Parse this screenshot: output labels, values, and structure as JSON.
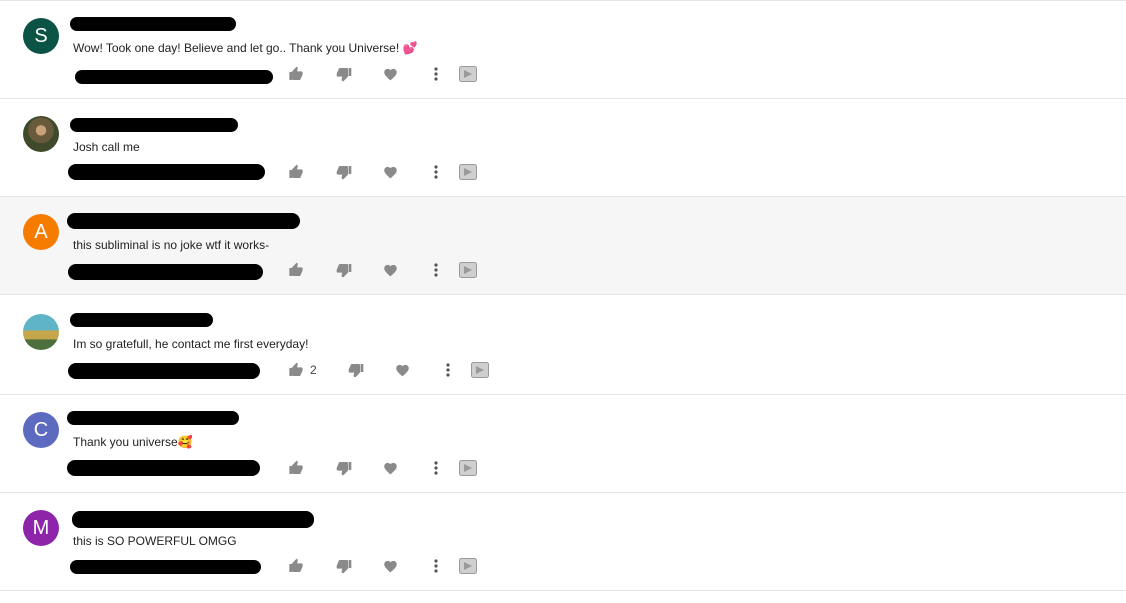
{
  "comments": [
    {
      "avatar_letter": "S",
      "avatar_color": "#0b5345",
      "text": "Wow! Took one day! Believe and let go.. Thank you Universe! 💕",
      "likes": ""
    },
    {
      "avatar_letter": "",
      "avatar_color": "",
      "text": "Josh call me",
      "likes": ""
    },
    {
      "avatar_letter": "A",
      "avatar_color": "#f57c00",
      "text": "this subliminal is no joke wtf it works-",
      "likes": ""
    },
    {
      "avatar_letter": "",
      "avatar_color": "",
      "text": "Im so gratefull, he contact me first everyday!",
      "likes": "2"
    },
    {
      "avatar_letter": "C",
      "avatar_color": "#5c6bc0",
      "text": "Thank you universe🥰",
      "likes": ""
    },
    {
      "avatar_letter": "M",
      "avatar_color": "#8e24aa",
      "text": "this is SO POWERFUL OMGG",
      "likes": ""
    }
  ],
  "icons": {
    "like": "thumb-up-icon",
    "dislike": "thumb-down-icon",
    "heart": "heart-icon",
    "more": "more-vert-icon",
    "reply": "reply-icon"
  },
  "colors": {
    "icon": "#8a8a8a",
    "divider": "#e5e5e5",
    "highlight_row": "#f6f6f6"
  }
}
